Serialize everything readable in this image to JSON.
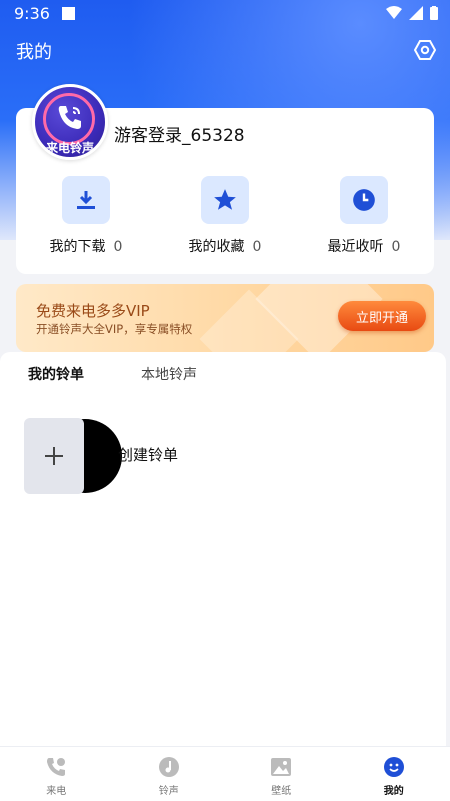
{
  "status_bar": {
    "time": "9:36"
  },
  "header": {
    "title": "我的"
  },
  "profile": {
    "avatar_text": "来电铃声",
    "username": "游客登录_65328",
    "stats": [
      {
        "label": "我的下载",
        "count": "0",
        "icon": "download-icon"
      },
      {
        "label": "我的收藏",
        "count": "0",
        "icon": "star-icon"
      },
      {
        "label": "最近收听",
        "count": "0",
        "icon": "clock-icon"
      }
    ]
  },
  "vip": {
    "title": "免费来电多多VIP",
    "subtitle": "开通铃声大全VIP，享专属特权",
    "button": "立即开通"
  },
  "tabs": [
    {
      "label": "我的铃单",
      "active": true
    },
    {
      "label": "本地铃声",
      "active": false
    }
  ],
  "playlist": {
    "create_label": "创建铃单"
  },
  "bottom_nav": [
    {
      "label": "来电",
      "icon": "phone-icon",
      "active": false
    },
    {
      "label": "铃声",
      "icon": "music-note-icon",
      "active": false
    },
    {
      "label": "壁纸",
      "icon": "image-icon",
      "active": false
    },
    {
      "label": "我的",
      "icon": "smiley-icon",
      "active": true
    }
  ],
  "colors": {
    "accent": "#1f4fd6",
    "tile_bg": "#dbe8ff",
    "vip_button": "#e84a12"
  }
}
